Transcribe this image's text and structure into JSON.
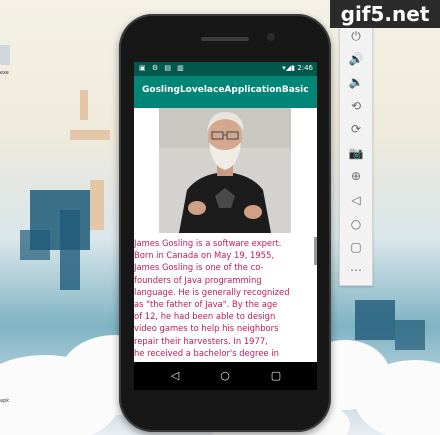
{
  "watermark": "gif5.net",
  "desktop": {
    "icon_label_1": "exe",
    "icon_label_2": "apk"
  },
  "status_bar": {
    "left_icons": "▣ ⚙ ▤ ▥",
    "time": "2:46"
  },
  "app_bar": {
    "title": "GoslingLovelaceApplicationBasic"
  },
  "photo": {
    "subject": "portrait photo of James Gosling"
  },
  "bio_lines": [
    "James Gosling is a software expert.",
    "Born in Canada on May 19, 1955,",
    "James Gosling is one of the co-",
    "founders of Java programming",
    "language. He is generally recognized",
    "as \"the father of Java\". By the age",
    "of 12, he had been able to design",
    "video games to help his neighbors",
    "repair their harvesters. In 1977,",
    "he received a bachelor's degree in"
  ],
  "toolbar": [
    "power-icon",
    "volume-up-icon",
    "volume-down-icon",
    "rotate-left-icon",
    "rotate-right-icon",
    "camera-icon",
    "zoom-icon",
    "back-icon",
    "home-icon",
    "overview-icon",
    "more-icon"
  ],
  "toolbar_glyphs": [
    "⏻",
    "🔊",
    "🔉",
    "⟲",
    "⟳",
    "📷",
    "⊕",
    "◁",
    "○",
    "▢",
    "⋯"
  ],
  "nav": {
    "back": "◁",
    "home": "○",
    "recents": "▢"
  },
  "colors": {
    "primary": "#008577",
    "primary_dark": "#00574b",
    "text": "#c2185b"
  }
}
